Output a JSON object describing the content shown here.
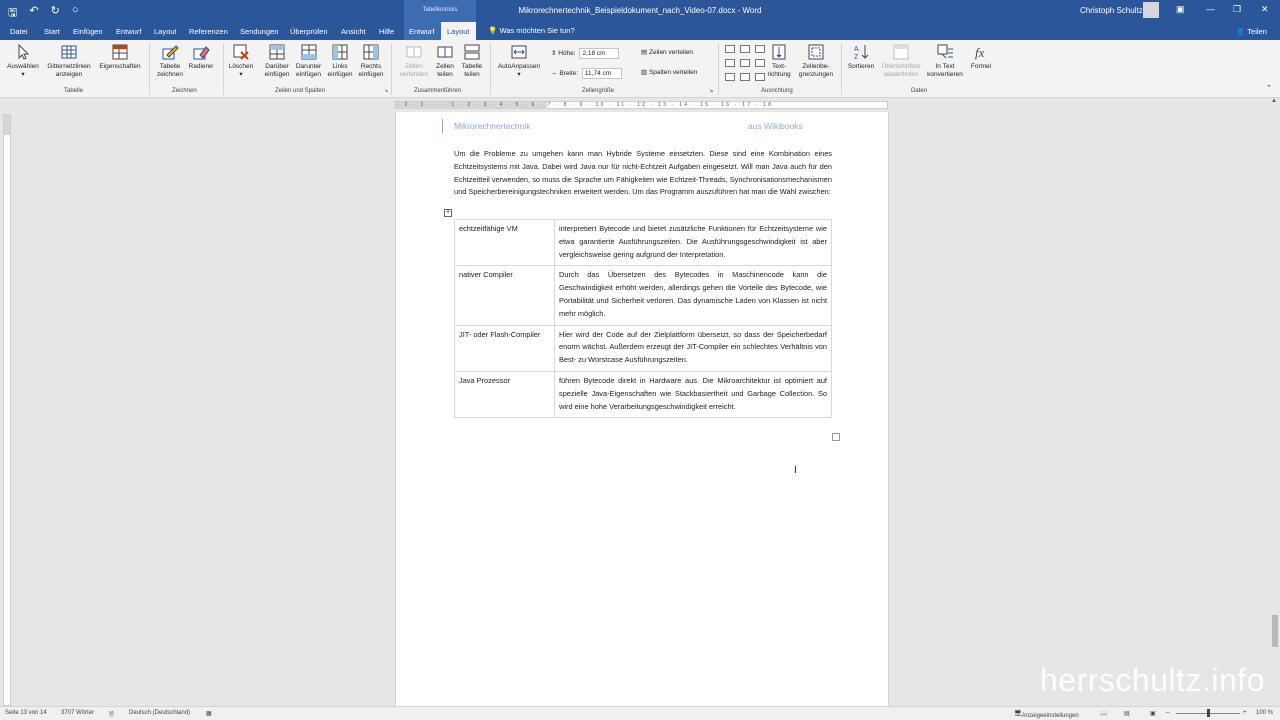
{
  "titlebar": {
    "context_label": "Tabellentools",
    "document_title": "Mikrorechnertechnik_Beispieldokument_nach_Video-07.docx - Word",
    "user": "Christoph Schultz"
  },
  "tabs": {
    "file": "Datei",
    "start": "Start",
    "insert": "Einfügen",
    "design": "Entwurf",
    "layout": "Layout",
    "references": "Referenzen",
    "mailings": "Sendungen",
    "review": "Überprüfen",
    "view": "Ansicht",
    "help": "Hilfe",
    "table_design": "Entwurf",
    "table_layout": "Layout",
    "tell_me": "Was möchten Sie tun?",
    "share": "Teilen"
  },
  "ribbon": {
    "table": {
      "select": "Auswählen",
      "gridlines": "Gitternetzlinien anzeigen",
      "properties": "Eigenschaften",
      "group": "Tabelle"
    },
    "draw": {
      "draw_table": "Tabelle zeichnen",
      "eraser": "Radierer",
      "group": "Zeichnen"
    },
    "rows_cols": {
      "delete": "Löschen",
      "insert_above": "Darüber einfügen",
      "insert_below": "Darunter einfügen",
      "insert_left": "Links einfügen",
      "insert_right": "Rechts einfügen",
      "group": "Zeilen und Spalten"
    },
    "merge": {
      "merge_cells": "Zellen verbinden",
      "split_cells": "Zellen teilen",
      "split_table": "Tabelle teilen",
      "group": "Zusammenführen"
    },
    "cell_size": {
      "autofit": "AutoAnpassen",
      "height_label": "Höhe:",
      "height_value": "2,18 cm",
      "width_label": "Breite:",
      "width_value": "11,74 cm",
      "distribute_rows": "Zeilen verteilen",
      "distribute_cols": "Spalten verteilen",
      "group": "Zellengröße"
    },
    "alignment": {
      "text_direction": "Text- richtung",
      "cell_margins": "Zellenbe- grenzungen",
      "group": "Ausrichtung"
    },
    "data": {
      "sort": "Sortieren",
      "repeat_header": "Überschriften wiederholen",
      "convert": "In Text konvertieren",
      "formula": "Formel",
      "group": "Daten"
    }
  },
  "ruler": {
    "ticks": "· 2 · 1 · · · 1 · 2 · 3 · 4 · 5 · 6 · 7 · 8 · 9 · 10 · 11 · 12 · 13 · 14 · 15 · 16 · 17 · 18"
  },
  "document": {
    "header_left": "Mikrorechnertechnik",
    "header_right": "aus Wikibooks",
    "paragraph": "Um die Probleme zu umgehen kann man Hybride Systeme einsetzten. Diese sind eine Kombination eines Echtzeitsystems mit Java. Dabei wird Java nur für nicht-Echtzeit Aufgaben eingesetzt. Will man Java auch für den Echtzeitteil verwenden, so muss die Sprache um Fähigkeiten wie Echtzeit-Threads, Synchronisationsmechanismen und Speicherbereinigungstechniken erweitert werden. Um das Programm auszuführen hat man die Wahl zwischen:",
    "table": [
      {
        "term": "echtzeitfähige VM",
        "desc": "interpretiert Bytecode und bietet zusätzliche Funktionen für Echtzeitsysteme wie etwa garantierte Ausführungszeiten. Die Ausführungsgeschwindigkeit ist aber vergleichsweise gering aufgrund der Interpretation."
      },
      {
        "term": "nativer Compiler",
        "desc": "Durch das Übersetzen des Bytecodes in Maschinencode kann die Geschwindigkeit erhöht werden, allerdings gehen die Vorteile des Bytecode, wie Portabilität und Sicherheit verloren. Das dynamische Laden von Klassen ist nicht mehr möglich."
      },
      {
        "term": "JIT- oder Flash-Compiler",
        "desc": "Hier wird der Code auf der Zielplattform übersetzt, so dass der Speicherbedarf enorm wächst. Außerdem erzeugt der JIT-Compiler ein schlechtes Verhältnis von Best- zu Worstcase Ausführungszeiten."
      },
      {
        "term": "Java Prozessor",
        "desc": "führen Bytecode direkt in Hardware aus. Die Mikroarchitektur ist optimiert auf spezielle Java-Eigenschaften wie Stackbasiertheit und Garbage Collection. So wird eine hohe Verarbeitungsgeschwindigkeit erreicht."
      }
    ]
  },
  "watermark": "herrschultz.info",
  "status": {
    "page": "Seite 13 von 14",
    "words": "3707 Wörter",
    "language": "Deutsch (Deutschland)",
    "display_settings": "Anzeigeeinstellungen",
    "zoom": "100 %"
  }
}
